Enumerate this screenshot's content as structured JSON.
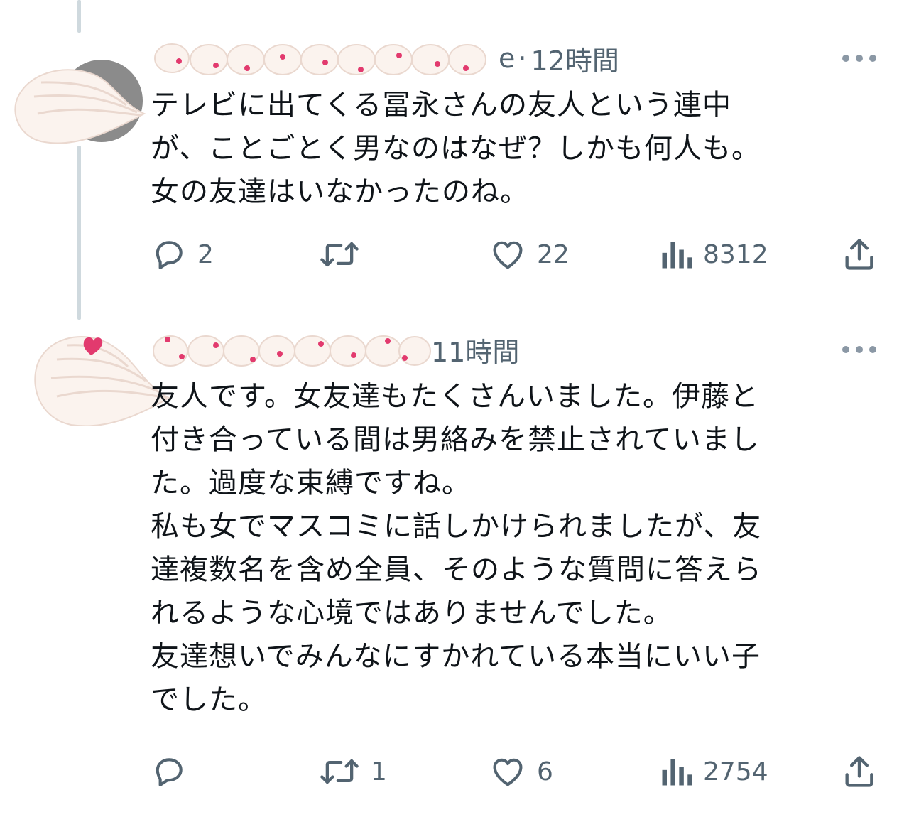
{
  "tweets": [
    {
      "name_visible_fragment": "e",
      "separator": "·",
      "time": "12時間",
      "text": "テレビに出てくる冨永さんの友人という連中\nが、ことごとく男なのはなぜ？しかも何人も。\n女の友達はいなかったのね。",
      "reply_count": "2",
      "retweet_count": "",
      "like_count": "22",
      "view_count": "8312"
    },
    {
      "name_visible_fragment": "",
      "separator": "",
      "time": "11時間",
      "text": "友人です。女友達もたくさんいました。伊藤と\n付き合っている間は男絡みを禁止されていまし\nた。過度な束縛ですね。\n私も女でマスコミに話しかけられましたが、友\n達複数名を含め全員、そのような質問に答えら\nれるような心境ではありませんでした。\n友達想いでみんなにすかれている本当にいい子\nでした。",
      "reply_count": "",
      "retweet_count": "1",
      "like_count": "6",
      "view_count": "2754"
    }
  ],
  "icons": {
    "reply": "reply-icon",
    "retweet": "retweet-icon",
    "like": "heart-icon",
    "views": "views-icon",
    "share": "share-icon",
    "more": "more-icon"
  },
  "colors": {
    "text": "#0f1419",
    "secondary": "#536471",
    "thread_line": "#cfd9de",
    "sticker_heart": "#e23a6e"
  }
}
